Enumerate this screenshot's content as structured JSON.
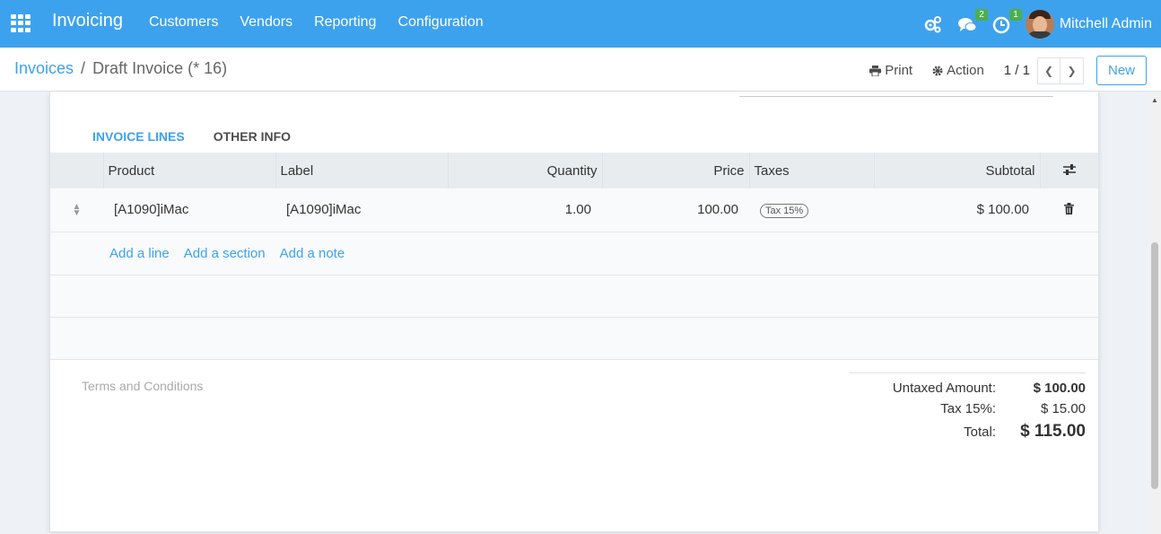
{
  "navbar": {
    "brand": "Invoicing",
    "menu": [
      "Customers",
      "Vendors",
      "Reporting",
      "Configuration"
    ],
    "messages_badge": "2",
    "activities_badge": "1",
    "user_name": "Mitchell Admin"
  },
  "control_panel": {
    "breadcrumb_parent": "Invoices",
    "breadcrumb_current": "Draft Invoice (* 16)",
    "print_label": "Print",
    "action_label": "Action",
    "pager": "1 / 1",
    "new_label": "New"
  },
  "tabs": [
    "INVOICE LINES",
    "OTHER INFO"
  ],
  "table": {
    "headers": [
      "Product",
      "Label",
      "Quantity",
      "Price",
      "Taxes",
      "Subtotal"
    ],
    "rows": [
      {
        "product": "[A1090]iMac",
        "label": "[A1090]iMac",
        "quantity": "1.00",
        "price": "100.00",
        "tax": "Tax 15%",
        "subtotal": "$ 100.00"
      }
    ],
    "add_line": "Add a line",
    "add_section": "Add a section",
    "add_note": "Add a note"
  },
  "footer": {
    "terms_placeholder": "Terms and Conditions",
    "untaxed_label": "Untaxed Amount:",
    "untaxed_value": "$ 100.00",
    "tax_label": "Tax 15%:",
    "tax_value": "$ 15.00",
    "total_label": "Total:",
    "total_value": "$ 115.00"
  },
  "colors": {
    "brand": "#3da2ee",
    "badge": "#4caf50"
  }
}
